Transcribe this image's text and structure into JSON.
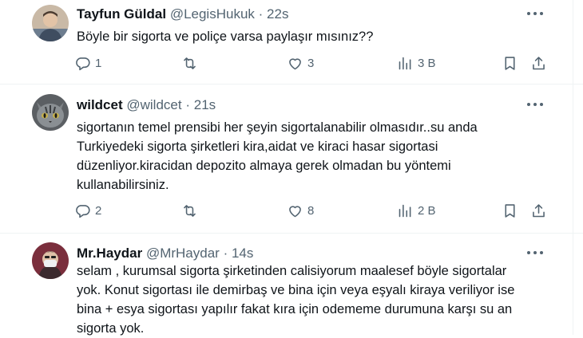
{
  "tweets": [
    {
      "name": "Tayfun Güldal",
      "handle": "@LegisHukuk",
      "sep": "·",
      "time": "22s",
      "text": "Böyle bir sigorta ve poliçe varsa paylaşır mısınız??",
      "replies": "1",
      "retweets": "",
      "likes": "3",
      "views": "3 B"
    },
    {
      "name": "wildcet",
      "handle": "@wildcet",
      "sep": "·",
      "time": "21s",
      "text_lines": [
        "sigortanın temel prensibi her şeyin sigortalanabilir olmasıdır..su anda",
        "Turkiyedeki sigorta şirketleri kira,aidat ve kiraci hasar sigortasi",
        "düzenliyor.kiracidan depozito almaya gerek olmadan bu yöntemi",
        "kullanabilirsiniz."
      ],
      "replies": "2",
      "retweets": "",
      "likes": "8",
      "views": "2 B"
    },
    {
      "name": "Mr.Haydar",
      "handle": "@MrHaydar",
      "sep": "·",
      "time": "14s",
      "text_lines": [
        "selam , kurumsal sigorta şirketinden calisiyorum maalesef böyle sigortalar",
        "yok. Konut sigortası ile demirbaş ve bina için veya eşyalı kiraya veriliyor ise",
        "bina + esya sigortası yapılır fakat kıra için odememe durumuna karşı su an",
        "sigorta yok."
      ]
    }
  ],
  "icons": [
    "more-icon",
    "reply-icon",
    "retweet-icon",
    "like-icon",
    "views-icon",
    "bookmark-icon",
    "share-icon"
  ]
}
